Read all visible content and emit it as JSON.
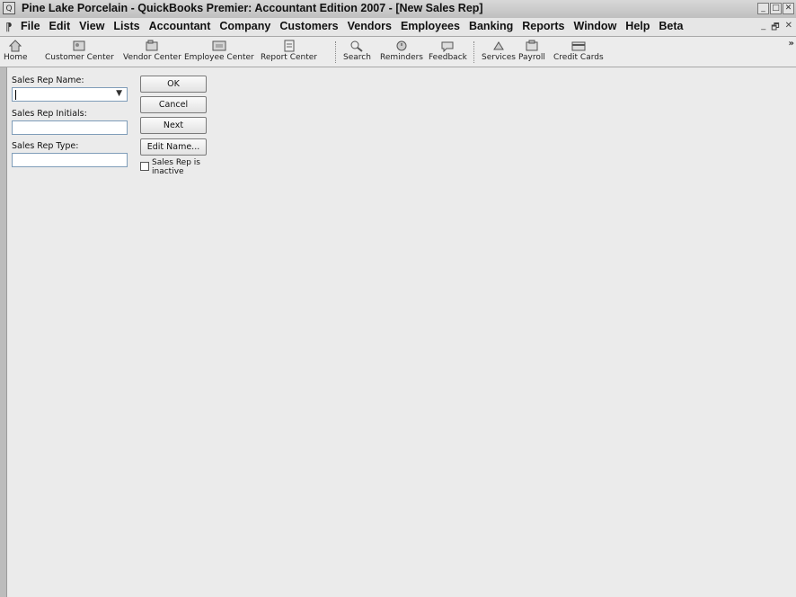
{
  "window": {
    "title": "Pine Lake Porcelain - QuickBooks Premier: Accountant Edition 2007 - [New Sales Rep]",
    "controls": [
      "_",
      "□",
      "✕"
    ]
  },
  "menu": {
    "gutter": "⁋",
    "items": [
      "File",
      "Edit",
      "View",
      "Lists",
      "Accountant",
      "Company",
      "Customers",
      "Vendors",
      "Employees",
      "Banking",
      "Reports",
      "Window",
      "Help",
      "Beta"
    ],
    "doc_controls": [
      "_",
      "🗗",
      "✕"
    ]
  },
  "toolbar": {
    "items": [
      {
        "label": "Home",
        "icon": "home-icon"
      },
      {
        "label": "Customer Center",
        "icon": "customer-center-icon"
      },
      {
        "label": "Vendor Center",
        "icon": "vendor-center-icon"
      },
      {
        "label": "Employee Center",
        "icon": "employee-center-icon"
      },
      {
        "label": "Report Center",
        "icon": "report-center-icon"
      },
      {
        "label": "Search",
        "icon": "search-icon"
      },
      {
        "label": "Reminders",
        "icon": "reminders-icon"
      },
      {
        "label": "Feedback",
        "icon": "feedback-icon"
      },
      {
        "label": "Services",
        "icon": "services-icon"
      },
      {
        "label": "Payroll",
        "icon": "payroll-icon"
      },
      {
        "label": "Credit Cards",
        "icon": "credit-cards-icon"
      }
    ],
    "overflow": "»"
  },
  "form": {
    "name_label": "Sales Rep Name:",
    "name_value": "",
    "initials_label": "Sales Rep Initials:",
    "initials_value": "",
    "type_label": "Sales Rep Type:",
    "type_value": "",
    "inactive_label": "Sales Rep is inactive",
    "inactive_checked": false
  },
  "buttons": {
    "ok": "OK",
    "cancel": "Cancel",
    "next": "Next",
    "edit_name": "Edit Name..."
  }
}
